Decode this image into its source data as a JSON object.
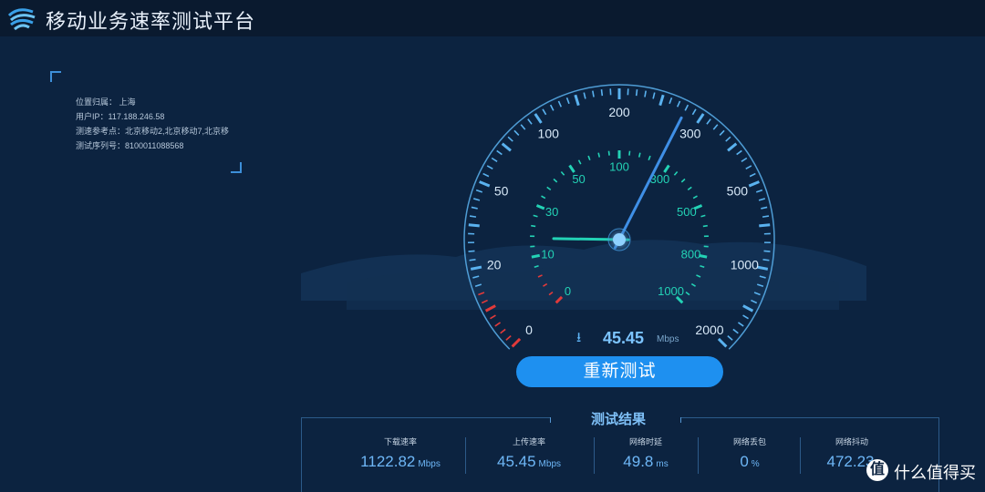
{
  "app": {
    "title": "移动业务速率测试平台"
  },
  "info": {
    "location": "位置归属： 上海",
    "ip": "用户IP：117.188.246.58",
    "ref": "测速参考点：北京移动2,北京移动7,北京移",
    "serial": "测试序列号：8100011088568"
  },
  "gauge": {
    "outer_labels": [
      "0",
      "20",
      "50",
      "100",
      "200",
      "300",
      "500",
      "1000",
      "2000"
    ],
    "inner_labels": [
      "0",
      "10",
      "30",
      "50",
      "100",
      "300",
      "500",
      "800",
      "1000"
    ],
    "outer_value_pos": 0.6,
    "inner_value_pos": 0.17,
    "colors": {
      "outer": "#5ab2ef",
      "inner": "#23d2b5",
      "low": "#e23a3a"
    }
  },
  "speed": {
    "icon": "download-arrow-icon",
    "value": "45.45",
    "unit": "Mbps"
  },
  "retest_button": "重新测试",
  "results": {
    "title": "测试结果",
    "items": [
      {
        "label": "下载速率",
        "value": "1122.82",
        "unit": "Mbps"
      },
      {
        "label": "上传速率",
        "value": "45.45",
        "unit": "Mbps"
      },
      {
        "label": "网络时延",
        "value": "49.8",
        "unit": "ms"
      },
      {
        "label": "网络丢包",
        "value": "0",
        "unit": "%"
      },
      {
        "label": "网络抖动",
        "value": "472.23",
        "unit": ""
      }
    ]
  },
  "watermark": {
    "text": "什么值得买",
    "glyph": "值"
  }
}
